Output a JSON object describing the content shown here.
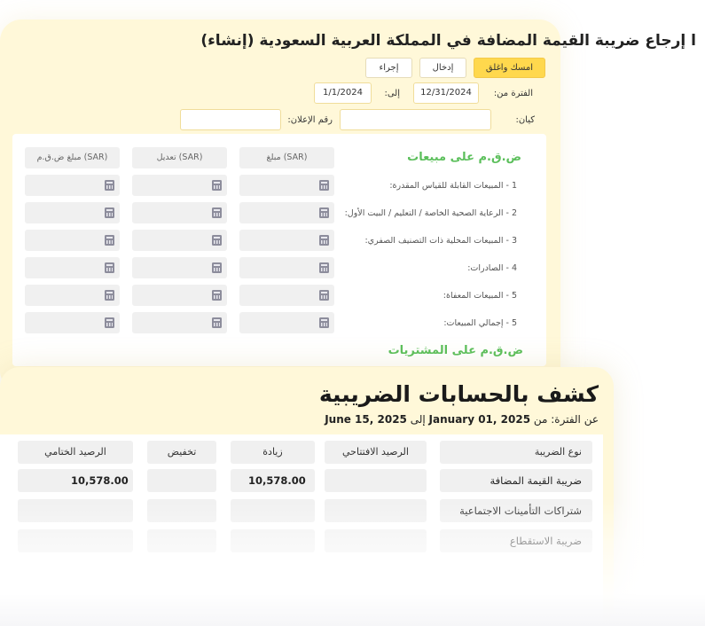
{
  "vat_return": {
    "title": "ا إرجاع ضريبة القيمة المضافة في المملكة العربية السعودية (إنشاء)",
    "buttons": {
      "save_close": "امسك واغلق",
      "enter": "إدخال",
      "action": "إجراء"
    },
    "period_from_label": "الفترة من:",
    "period_from_value": "12/31/2024",
    "period_to_label": "إلى:",
    "period_to_value": "1/1/2024",
    "entity_label": "كيان:",
    "entity_value": "",
    "declaration_label": "رقم الإعلان:",
    "declaration_value": "",
    "sales_section_title": "ض.ق.م على مبيعات",
    "purchases_section_title": "ض.ق.م على المشتريات",
    "columns": [
      "مبلغ (SAR)",
      "تعديل (SAR)",
      "مبلغ ض.ق.م (SAR)"
    ],
    "rows": [
      "1 - المبيعات القابلة للقياس المقدرة:",
      "2 - الرعاية الصحية الخاصة / التعليم / البيت الأول:",
      "3 - المبيعات المحلية ذات التصنيف الصفري:",
      "4 - الصادرات:",
      "5 - المبيعات المعفاة:",
      "5 - إجمالي المبيعات:"
    ]
  },
  "tax_statement": {
    "title": "كشف بالحسابات الضريبية",
    "period_prefix": "عن الفترة: من",
    "period_from": "January 01, 2025",
    "period_sep": "إلى",
    "period_to": "June 15, 2025",
    "headers": [
      "نوع الضريبة",
      "الرصيد الافتتاحي",
      "زيادة",
      "تخفيض",
      "الرصيد الختامي"
    ],
    "rows": [
      {
        "type": "ضريبة القيمة المضافة",
        "opening": "",
        "increase": "10,578.00",
        "decrease": "",
        "closing": "10,578.00"
      },
      {
        "type": "شتراكات التأمينات الاجتماعية",
        "opening": "",
        "increase": "",
        "decrease": "",
        "closing": ""
      },
      {
        "type": "ضريبة الاستقطاع",
        "opening": "",
        "increase": "",
        "decrease": "",
        "closing": ""
      }
    ]
  }
}
